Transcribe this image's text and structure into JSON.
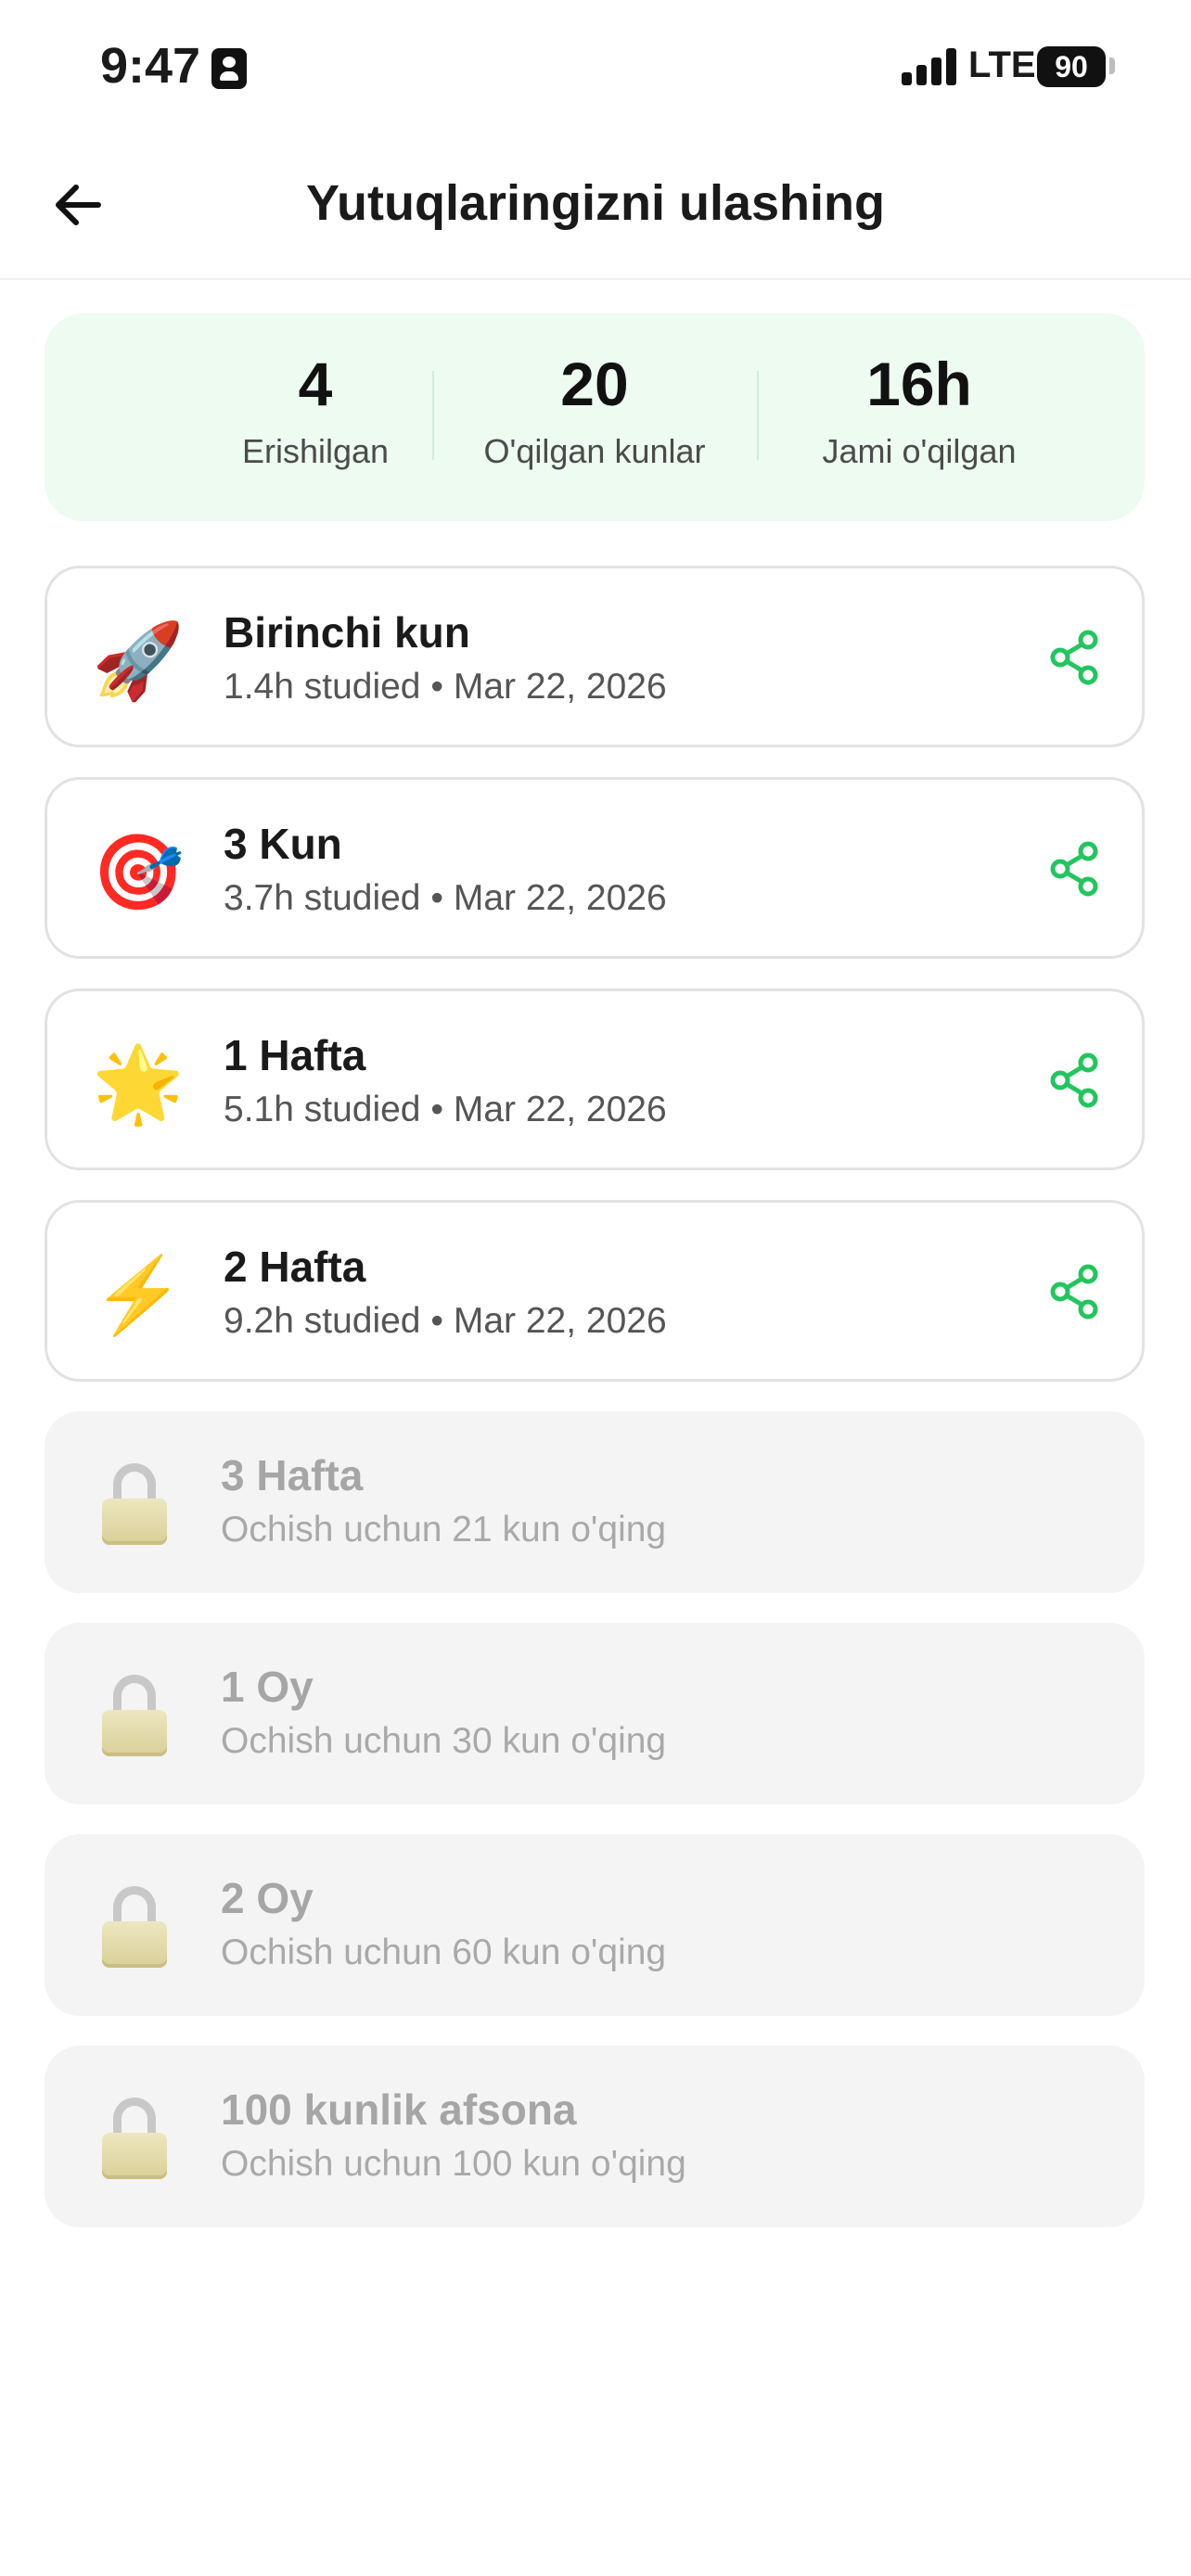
{
  "status_bar": {
    "time": "9:47",
    "network": "LTE",
    "battery": "90"
  },
  "header": {
    "title": "Yutuqlaringizni ulashing",
    "back_icon": "arrow-left-icon"
  },
  "stats": [
    {
      "value": "4",
      "label": "Erishilgan"
    },
    {
      "value": "20",
      "label": "O'qilgan kunlar"
    },
    {
      "value": "16h",
      "label": "Jami o'qilgan"
    }
  ],
  "colors": {
    "accent": "#22c55e",
    "stats_bg": "#edfbf1",
    "locked_bg": "#f4f4f4"
  },
  "achievements": [
    {
      "emoji": "🚀",
      "icon_name": "rocket-icon",
      "title": "Birinchi kun",
      "subtitle": "1.4h studied • Mar 22, 2026",
      "locked": false
    },
    {
      "emoji": "🎯",
      "icon_name": "target-icon",
      "title": "3 Kun",
      "subtitle": "3.7h studied • Mar 22, 2026",
      "locked": false
    },
    {
      "emoji": "🌟",
      "icon_name": "star-icon",
      "title": "1 Hafta",
      "subtitle": "5.1h studied • Mar 22, 2026",
      "locked": false
    },
    {
      "emoji": "⚡",
      "icon_name": "lightning-icon",
      "title": "2 Hafta",
      "subtitle": "9.2h studied • Mar 22, 2026",
      "locked": false
    },
    {
      "emoji": "🔒",
      "icon_name": "lock-icon",
      "title": "3 Hafta",
      "subtitle": "Ochish uchun 21 kun o'qing",
      "locked": true
    },
    {
      "emoji": "🔒",
      "icon_name": "lock-icon",
      "title": "1 Oy",
      "subtitle": "Ochish uchun 30 kun o'qing",
      "locked": true
    },
    {
      "emoji": "🔒",
      "icon_name": "lock-icon",
      "title": "2 Oy",
      "subtitle": "Ochish uchun 60 kun o'qing",
      "locked": true
    },
    {
      "emoji": "🔒",
      "icon_name": "lock-icon",
      "title": "100 kunlik afsona",
      "subtitle": "Ochish uchun 100 kun o'qing",
      "locked": true
    }
  ]
}
